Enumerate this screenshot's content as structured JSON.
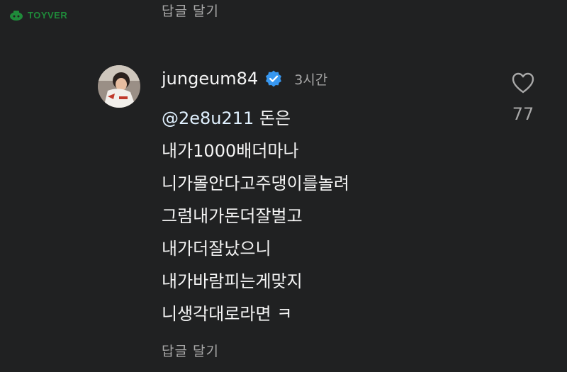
{
  "watermark": {
    "text": "TOYVER",
    "icon": "toyver-logo-icon",
    "color": "#1f8a3a"
  },
  "reply_top": {
    "label": "답글 달기"
  },
  "comment": {
    "avatar_icon": "profile-photo",
    "username": "jungeum84",
    "verified_icon": "verified-badge-icon",
    "verified_color": "#3797f0",
    "time": "3시간",
    "mention": "@2e8u211",
    "first_line_rest": " 돈은",
    "lines": [
      "내가1000배더마나",
      "니가몰안다고주댕이를놀려",
      "그럼내가돈더잘벌고",
      "내가더잘났으니",
      "내가바람피는게맞지",
      "니생각대로라면 ㅋ"
    ],
    "like_icon": "heart-outline-icon",
    "like_count": "77",
    "reply_label": "답글 달기"
  }
}
